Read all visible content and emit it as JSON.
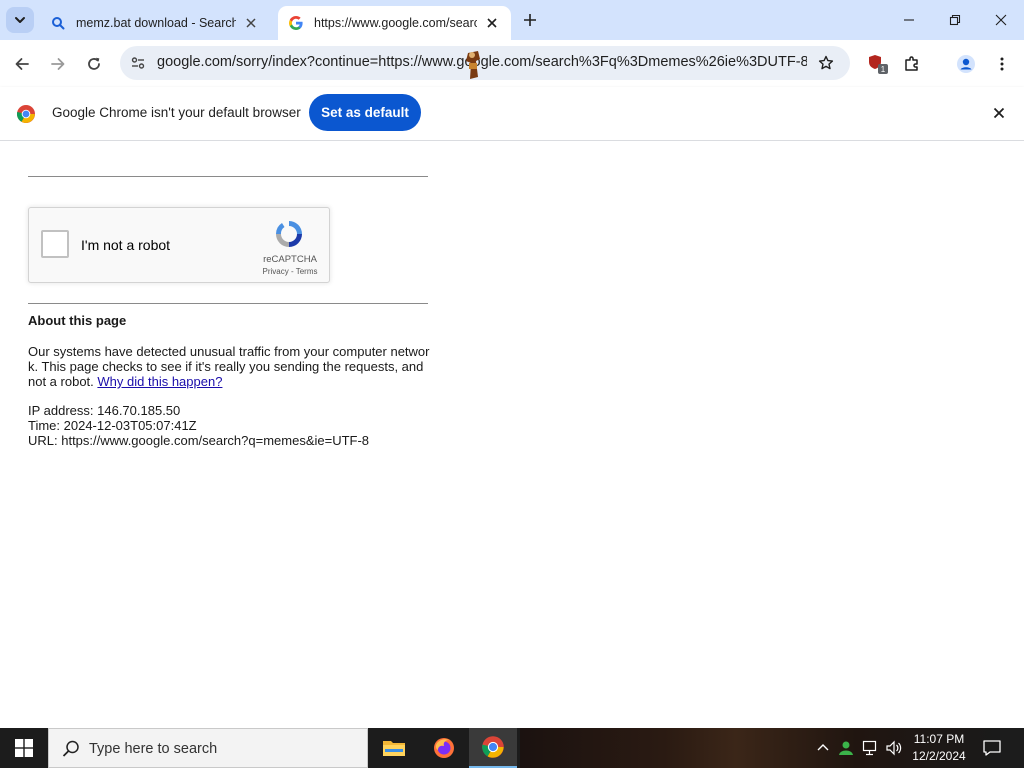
{
  "browser": {
    "tabs": [
      {
        "title": "memz.bat download - Search",
        "active": false
      },
      {
        "title": "https://www.google.com/search",
        "active": true
      }
    ],
    "address_bar": {
      "url": "google.com/sorry/index?continue=https://www.google.com/search%3Fq%3Dmemes%26ie%3DUTF-8&..."
    },
    "extension_badge": "1",
    "colors": {
      "tabstrip": "#d3e3fd",
      "accent": "#0b57d0",
      "omnibox": "#e9eef6"
    }
  },
  "infobar": {
    "message": "Google Chrome isn't your default browser",
    "button_label": "Set as default"
  },
  "page": {
    "recaptcha": {
      "checkbox_label": "I'm not a robot",
      "brand": "reCAPTCHA",
      "links": "Privacy - Terms"
    },
    "about_title": "About this page",
    "paragraph_text": "Our systems have detected unusual traffic from your computer network. This page checks to see if it's really you sending the requests, and not a robot.",
    "why_link": "Why did this happen?",
    "ip_line": "IP address: 146.70.185.50",
    "time_line": "Time: 2024-12-03T05:07:41Z",
    "url_line": "URL: https://www.google.com/search?q=memes&ie=UTF-8"
  },
  "taskbar": {
    "search_placeholder": "Type here to search",
    "pinned_apps": [
      "file-explorer",
      "firefox",
      "chrome"
    ],
    "active_app": "chrome",
    "time": "11:07 PM",
    "date": "12/2/2024"
  }
}
